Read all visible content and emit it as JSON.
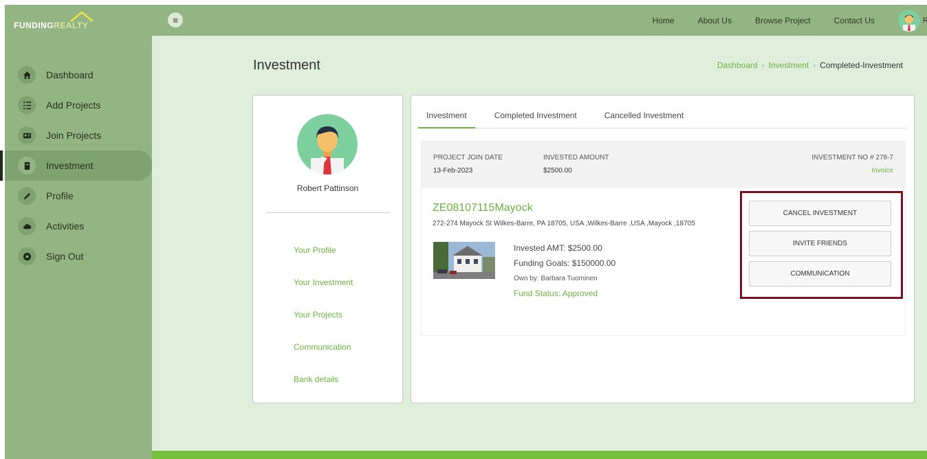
{
  "brand": {
    "part1": "FUNDING",
    "part2": "REALTY"
  },
  "sidebar": {
    "items": [
      {
        "label": "Dashboard",
        "icon": "home-icon"
      },
      {
        "label": "Add Projects",
        "icon": "list-icon"
      },
      {
        "label": "Join Projects",
        "icon": "id-card-icon"
      },
      {
        "label": "Investment",
        "icon": "book-icon",
        "active": true
      },
      {
        "label": "Profile",
        "icon": "pencil-icon"
      },
      {
        "label": "Activities",
        "icon": "cloud-icon"
      },
      {
        "label": "Sign Out",
        "icon": "power-icon"
      }
    ]
  },
  "topbar": {
    "menu_icon": "≡",
    "links": [
      "Home",
      "About Us",
      "Browse Project",
      "Contact Us"
    ],
    "user_initial_fragment": "R"
  },
  "page": {
    "title": "Investment",
    "breadcrumb": [
      "Dashboard",
      "Investment",
      "Completed-Investment"
    ]
  },
  "profile": {
    "name": "Robert Pattinson",
    "links": [
      "Your Profile",
      "Your Investment",
      "Your Projects",
      "Communication",
      "Bank details"
    ]
  },
  "tabs": [
    "Investment",
    "Completed Investment",
    "Cancelled Investment"
  ],
  "investment": {
    "join_date_label": "PROJECT JOIN DATE",
    "join_date": "13-Feb-2023",
    "amount_label": "INVESTED AMOUNT",
    "amount": "$2500.00",
    "number_label": "INVESTMENT NO # 278-7",
    "invoice": "Invoice",
    "project_title": "ZE08107115Mayock",
    "address": "272-274 Mayock St Wilkes-Barre, PA 18705, USA ,Wilkes-Barre ,USA ,Mayock ,18705",
    "invested_amt": "Invested AMT: $2500.00",
    "funding_goals": "Funding Goals: $150000.00",
    "owner": "Own by: Barbara Tuominen",
    "status": "Fund Status: Approved"
  },
  "actions": {
    "cancel": "CANCEL INVESTMENT",
    "invite": "INVITE FRIENDS",
    "communication": "COMMUNICATION"
  },
  "colors": {
    "sidebar": "#93b583",
    "main_bg": "#e0efdb",
    "accent": "#6ab23f",
    "highlight": "#7b0f1e",
    "footer": "#76c13c"
  }
}
